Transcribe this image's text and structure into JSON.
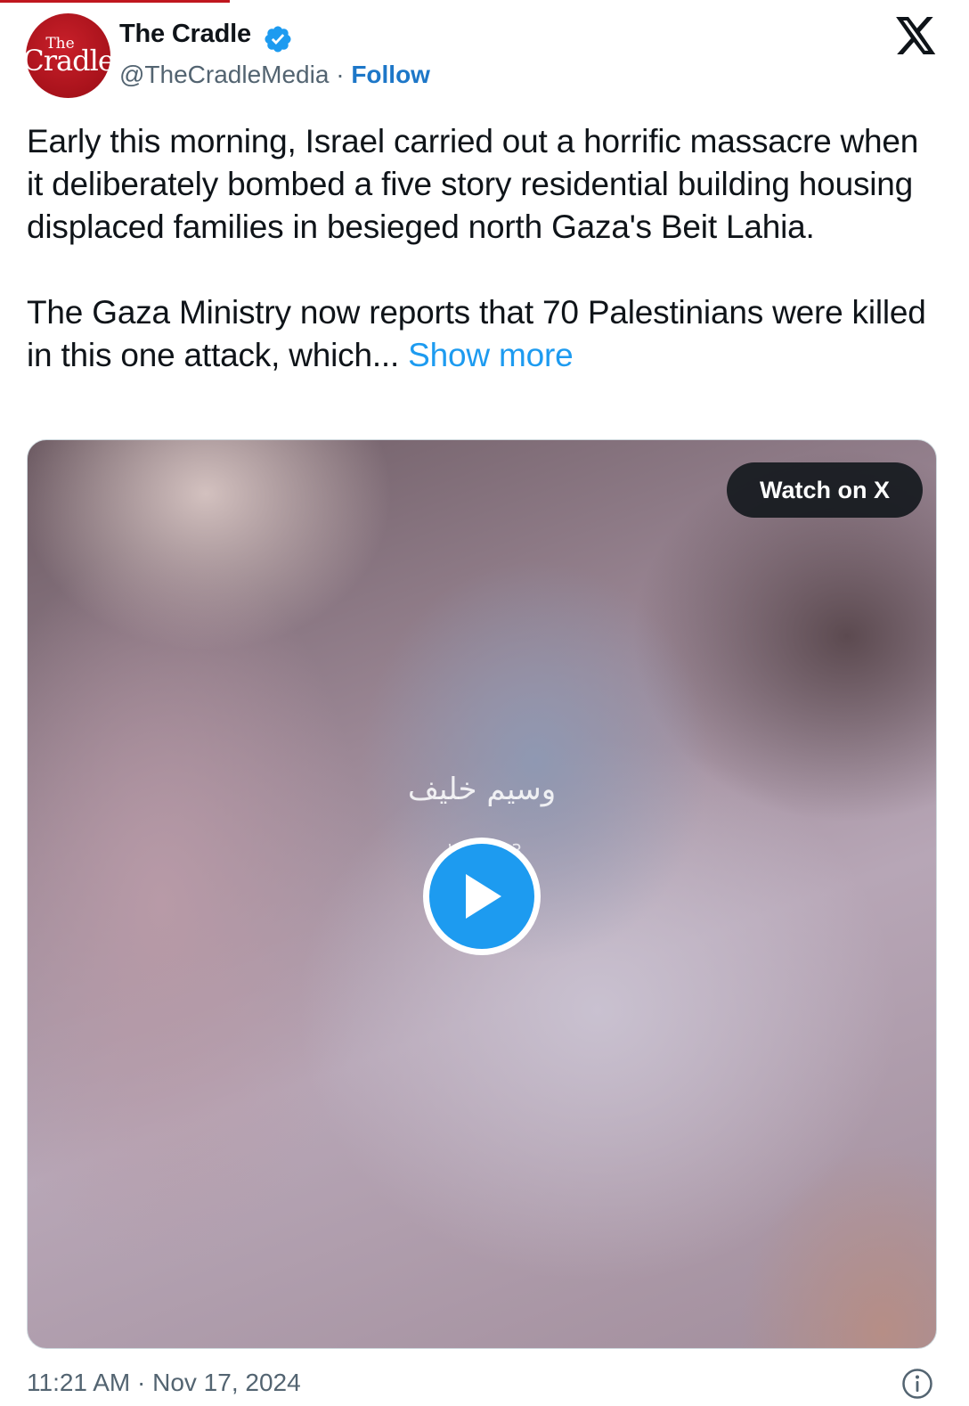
{
  "author": {
    "avatar_text_small": "The",
    "avatar_text_big": "Cradle",
    "name": "The Cradle",
    "handle": "@TheCradleMedia",
    "separator": "·",
    "follow_label": "Follow",
    "verified": true
  },
  "brand": {
    "icon": "x-logo-icon"
  },
  "tweet": {
    "paragraph_1": "Early this morning, Israel carried out a horrific massacre when it deliberately bombed a five story residential building housing displaced families in besieged north Gaza's Beit Lahia.",
    "paragraph_2": "The Gaza Ministry now reports that 70 Palestinians were killed in this one attack, which...",
    "show_more_label": "Show more"
  },
  "media": {
    "watch_label": "Watch on X",
    "watermark_arabic": "وسيم خليف",
    "watermark_id": "WS    003",
    "play_icon": "play-icon"
  },
  "footer": {
    "timestamp": "11:21 AM · Nov 17, 2024",
    "info_icon": "info-icon"
  },
  "colors": {
    "accent": "#1d9bf0",
    "follow": "#1d77c8",
    "muted": "#536471",
    "brand_red": "#a8121b"
  }
}
